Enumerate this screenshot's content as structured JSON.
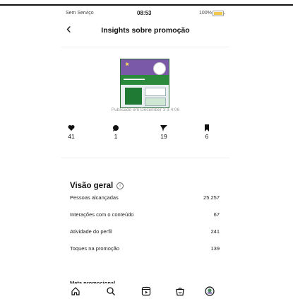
{
  "status_bar": {
    "carrier": "Sem Serviço",
    "time": "08:53",
    "battery_pct": "100%"
  },
  "header": {
    "title": "Insights sobre promoção"
  },
  "post": {
    "published": "Publicado em December 3 a 4:06"
  },
  "metrics": [
    {
      "icon": "heart-icon",
      "value": "41"
    },
    {
      "icon": "comment-icon",
      "value": "1"
    },
    {
      "icon": "share-icon",
      "value": "19"
    },
    {
      "icon": "bookmark-icon",
      "value": "6"
    }
  ],
  "overview": {
    "title": "Visão geral",
    "rows": [
      {
        "label": "Pessoas alcançadas",
        "value": "25.257"
      },
      {
        "label": "Interações com o conteúdo",
        "value": "67"
      },
      {
        "label": "Atividade do perfil",
        "value": "241"
      },
      {
        "label": "Toques na promoção",
        "value": "139"
      }
    ]
  },
  "promo_goal": {
    "title": "Meta promocional"
  },
  "nav": {
    "items": [
      "home-icon",
      "search-icon",
      "reels-icon",
      "shop-icon",
      "profile-icon"
    ]
  }
}
